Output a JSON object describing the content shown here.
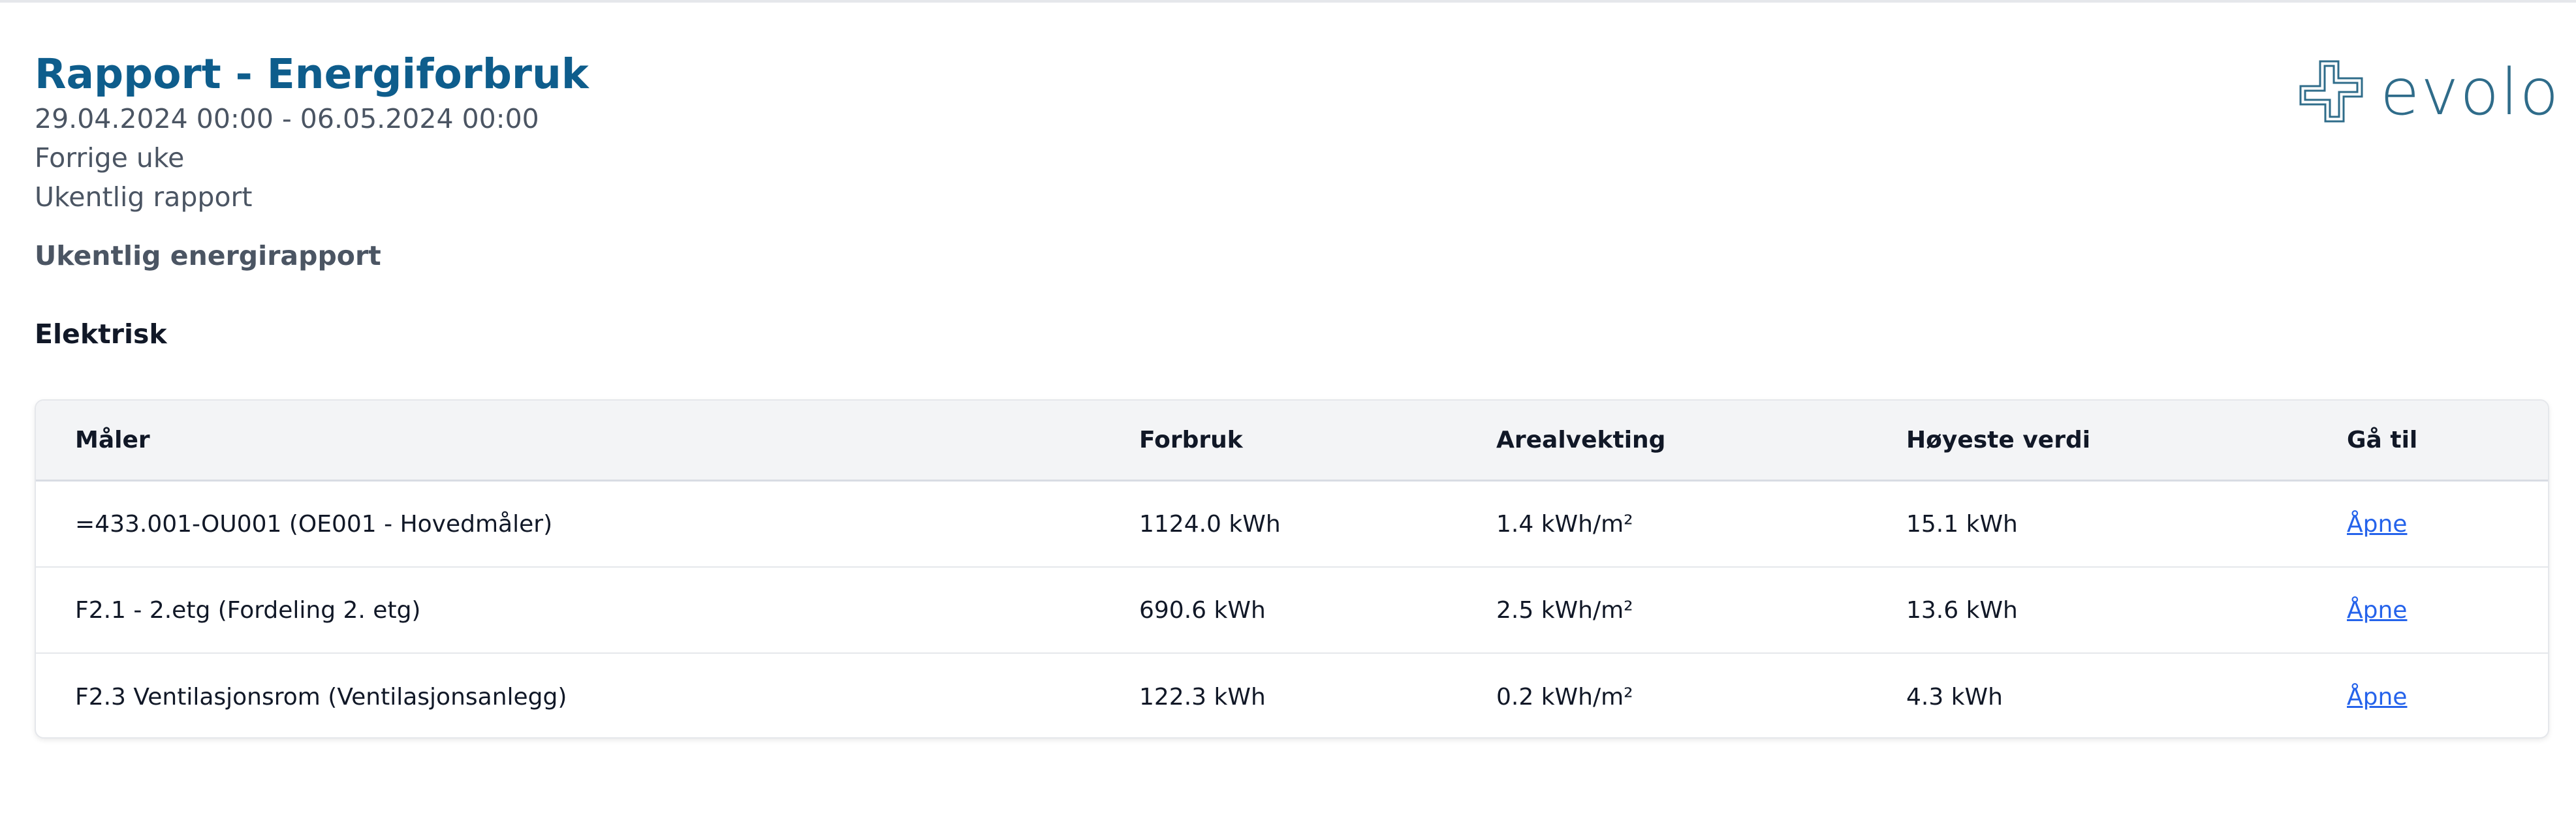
{
  "report": {
    "title": "Rapport - Energiforbruk",
    "date_range": "29.04.2024 00:00 - 06.05.2024 00:00",
    "period": "Forrige uke",
    "kind": "Ukentlig rapport",
    "subheading": "Ukentlig energirapport"
  },
  "logo": {
    "text": "evolo",
    "icon": "cross-logo-icon",
    "color": "#2f6c8a"
  },
  "section": {
    "title": "Elektrisk"
  },
  "table": {
    "columns": [
      "Måler",
      "Forbruk",
      "Arealvekting",
      "Høyeste verdi",
      "Gå til"
    ],
    "rows": [
      {
        "meter": "=433.001-OU001 (OE001 - Hovedmåler)",
        "consumption": "1124.0 kWh",
        "area_weighting": "1.4 kWh/m²",
        "peak": "15.1 kWh",
        "link": "Åpne"
      },
      {
        "meter": "F2.1 - 2.etg (Fordeling 2. etg)",
        "consumption": "690.6 kWh",
        "area_weighting": "2.5 kWh/m²",
        "peak": "13.6 kWh",
        "link": "Åpne"
      },
      {
        "meter": "F2.3 Ventilasjonsrom (Ventilasjonsanlegg)",
        "consumption": "122.3 kWh",
        "area_weighting": "0.2 kWh/m²",
        "peak": "4.3 kWh",
        "link": "Åpne"
      }
    ]
  },
  "colors": {
    "title": "#0e5d8c",
    "link": "#2563eb",
    "header_bg": "#f3f4f6"
  }
}
